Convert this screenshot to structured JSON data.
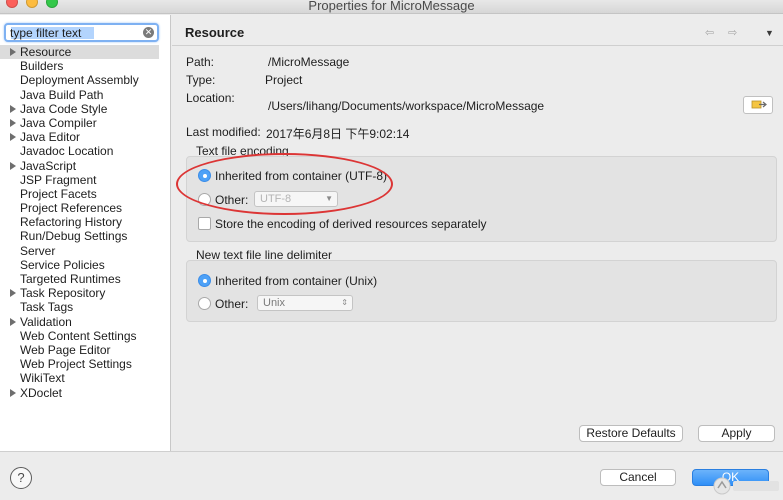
{
  "window": {
    "title": "Properties for MicroMessage"
  },
  "sidebar": {
    "filter": {
      "value": "type filter text"
    },
    "items": [
      {
        "label": "Resource",
        "expandable": true,
        "selected": true
      },
      {
        "label": "Builders",
        "expandable": false
      },
      {
        "label": "Deployment Assembly",
        "expandable": false
      },
      {
        "label": "Java Build Path",
        "expandable": false
      },
      {
        "label": "Java Code Style",
        "expandable": true
      },
      {
        "label": "Java Compiler",
        "expandable": true
      },
      {
        "label": "Java Editor",
        "expandable": true
      },
      {
        "label": "Javadoc Location",
        "expandable": false
      },
      {
        "label": "JavaScript",
        "expandable": true
      },
      {
        "label": "JSP Fragment",
        "expandable": false
      },
      {
        "label": "Project Facets",
        "expandable": false
      },
      {
        "label": "Project References",
        "expandable": false
      },
      {
        "label": "Refactoring History",
        "expandable": false
      },
      {
        "label": "Run/Debug Settings",
        "expandable": false
      },
      {
        "label": "Server",
        "expandable": false
      },
      {
        "label": "Service Policies",
        "expandable": false
      },
      {
        "label": "Targeted Runtimes",
        "expandable": false
      },
      {
        "label": "Task Repository",
        "expandable": true
      },
      {
        "label": "Task Tags",
        "expandable": false
      },
      {
        "label": "Validation",
        "expandable": true
      },
      {
        "label": "Web Content Settings",
        "expandable": false
      },
      {
        "label": "Web Page Editor",
        "expandable": false
      },
      {
        "label": "Web Project Settings",
        "expandable": false
      },
      {
        "label": "WikiText",
        "expandable": false
      },
      {
        "label": "XDoclet",
        "expandable": true
      }
    ]
  },
  "page": {
    "title": "Resource",
    "nav": {
      "back": "⇦",
      "forward": "⇨",
      "menu": "▼"
    },
    "path_label": "Path:",
    "path_value": "/MicroMessage",
    "type_label": "Type:",
    "type_value": "Project",
    "location_label": "Location:",
    "location_value": "/Users/lihang/Documents/workspace/MicroMessage",
    "modified_label": "Last modified:",
    "modified_value": "2017年6月8日 下午9:02:14"
  },
  "encoding": {
    "title": "Text file encoding",
    "inherited_label": "Inherited from container (UTF-8)",
    "other_label": "Other:",
    "other_value": "UTF-8",
    "store_label": "Store the encoding of derived resources separately"
  },
  "delimiter": {
    "title": "New text file line delimiter",
    "inherited_label": "Inherited from container (Unix)",
    "other_label": "Other:",
    "other_value": "Unix"
  },
  "buttons": {
    "restore": "Restore Defaults",
    "apply": "Apply",
    "cancel": "Cancel",
    "ok": "OK"
  },
  "watermark": {
    "text": "创新互联"
  },
  "colors": {
    "accent": "#4da1f7",
    "annotation": "#dc3535"
  }
}
